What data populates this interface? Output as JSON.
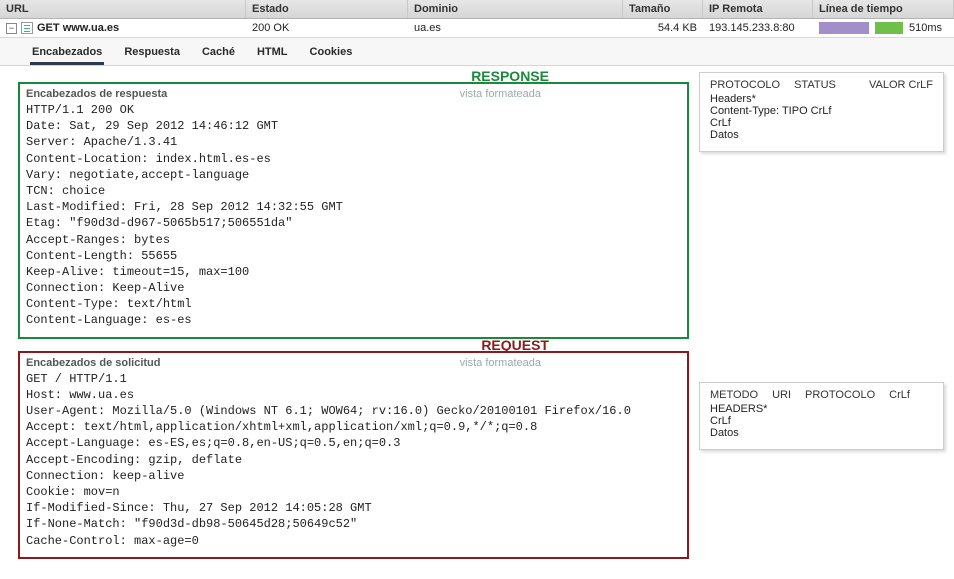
{
  "columns": {
    "url": "URL",
    "estado": "Estado",
    "dominio": "Dominio",
    "tamano": "Tamaño",
    "ip": "IP Remota",
    "timeline": "Línea de tiempo"
  },
  "row": {
    "method": "GET",
    "url": "www.ua.es",
    "status": "200 OK",
    "domain": "ua.es",
    "size": "54.4 KB",
    "ip": "193.145.233.8:80",
    "time": "510ms"
  },
  "tabs": {
    "encabezados": "Encabezados",
    "respuesta": "Respuesta",
    "cache": "Caché",
    "html": "HTML",
    "cookies": "Cookies"
  },
  "labels": {
    "response": "RESPONSE",
    "request": "REQUEST",
    "vistaFormateada": "vista formateada",
    "encResp": "Encabezados de respuesta",
    "encSol": "Encabezados de solicitud"
  },
  "respHeaders": "HTTP/1.1 200 OK\nDate: Sat, 29 Sep 2012 14:46:12 GMT\nServer: Apache/1.3.41\nContent-Location: index.html.es-es\nVary: negotiate,accept-language\nTCN: choice\nLast-Modified: Fri, 28 Sep 2012 14:32:55 GMT\nEtag: \"f90d3d-d967-5065b517;506551da\"\nAccept-Ranges: bytes\nContent-Length: 55655\nKeep-Alive: timeout=15, max=100\nConnection: Keep-Alive\nContent-Type: text/html\nContent-Language: es-es",
  "reqHeaders": "GET / HTTP/1.1\nHost: www.ua.es\nUser-Agent: Mozilla/5.0 (Windows NT 6.1; WOW64; rv:16.0) Gecko/20100101 Firefox/16.0\nAccept: text/html,application/xhtml+xml,application/xml;q=0.9,*/*;q=0.8\nAccept-Language: es-ES,es;q=0.8,en-US;q=0.5,en;q=0.3\nAccept-Encoding: gzip, deflate\nConnection: keep-alive\nCookie: mov=n\nIf-Modified-Since: Thu, 27 Sep 2012 14:05:28 GMT\nIf-None-Match: \"f90d3d-db98-50645d28;50649c52\"\nCache-Control: max-age=0",
  "sideResp": {
    "l1a": "PROTOCOLO",
    "l1b": "STATUS",
    "l1c": "VALOR CrLF",
    "l2": "Headers*",
    "l3": "Content-Type: TIPO CrLf",
    "l4": "CrLf",
    "l5": "Datos"
  },
  "sideReq": {
    "l1a": "METODO",
    "l1b": "URI",
    "l1c": "PROTOCOLO",
    "l1d": "CrLf",
    "l2": "HEADERS*",
    "l3": "CrLf",
    "l4": "Datos"
  }
}
